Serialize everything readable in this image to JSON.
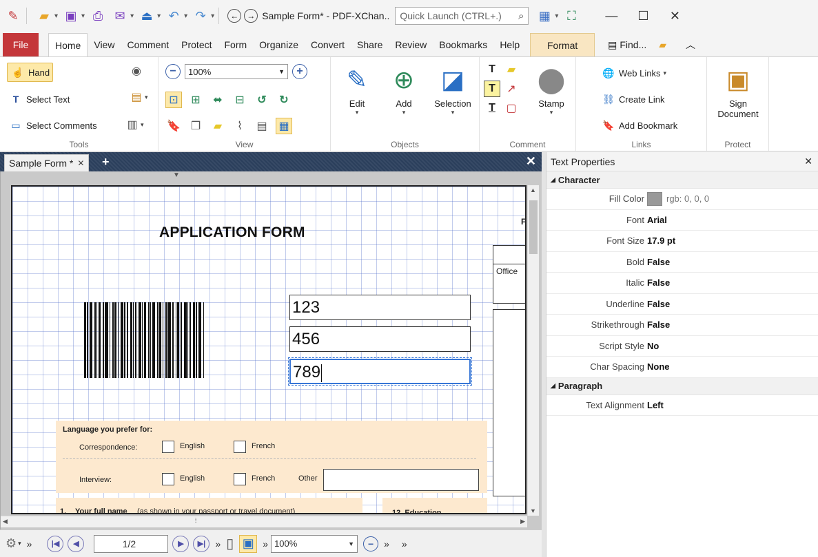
{
  "window": {
    "title": "Sample Form* - PDF-XChan..",
    "quick_launch_placeholder": "Quick Launch (CTRL+.)"
  },
  "menu": {
    "tabs": [
      "File",
      "Home",
      "View",
      "Comment",
      "Protect",
      "Form",
      "Organize",
      "Convert",
      "Share",
      "Review",
      "Bookmarks",
      "Help",
      "Format"
    ],
    "active": "Home",
    "find_label": "Find..."
  },
  "ribbon": {
    "tools": {
      "label": "Tools",
      "hand": "Hand",
      "select_text": "Select Text",
      "select_comments": "Select Comments"
    },
    "view": {
      "label": "View",
      "zoom": "100%"
    },
    "objects": {
      "label": "Objects",
      "edit": "Edit",
      "add": "Add",
      "selection": "Selection"
    },
    "comment": {
      "label": "Comment",
      "stamp": "Stamp"
    },
    "links": {
      "label": "Links",
      "web_links": "Web Links",
      "create_link": "Create Link",
      "add_bookmark": "Add Bookmark"
    },
    "protect": {
      "label": "Protect",
      "sign_line1": "Sign",
      "sign_line2": "Document"
    }
  },
  "document": {
    "tab_label": "Sample Form *",
    "heading": "APPLICATION FORM",
    "fields": [
      "123",
      "456",
      "789"
    ],
    "office_label": "Office",
    "page_mark": "F",
    "language_prompt": "Language you prefer for:",
    "correspondence_label": "Correspondence:",
    "interview_label": "Interview:",
    "english_label": "English",
    "french_label": "French",
    "other_label": "Other",
    "name_prompt_number": "1.",
    "name_prompt_bold": "Your full name",
    "name_prompt_rest": "(as shown in your passport or travel document)",
    "education_label": "12.  Education"
  },
  "statusbar": {
    "page_value": "1/2",
    "zoom": "100%"
  },
  "properties": {
    "title": "Text Properties",
    "sections": {
      "character": "Character",
      "paragraph": "Paragraph"
    },
    "fill_color_label": "Fill Color",
    "fill_color_value": "rgb: 0, 0, 0",
    "rows": [
      {
        "name": "Font",
        "value": "Arial"
      },
      {
        "name": "Font Size",
        "value": "17.9 pt"
      },
      {
        "name": "Bold",
        "value": "False"
      },
      {
        "name": "Italic",
        "value": "False"
      },
      {
        "name": "Underline",
        "value": "False"
      },
      {
        "name": "Strikethrough",
        "value": "False"
      },
      {
        "name": "Script Style",
        "value": "No"
      },
      {
        "name": "Char Spacing",
        "value": "None"
      }
    ],
    "paragraph_rows": [
      {
        "name": "Text Alignment",
        "value": "Left"
      }
    ]
  },
  "colors": {
    "file_tab": "#c4373a",
    "format_tab": "#f9e6c2",
    "form_highlight": "#fde9cf",
    "focus_border": "#3776d6",
    "grid": "#506ec8"
  }
}
